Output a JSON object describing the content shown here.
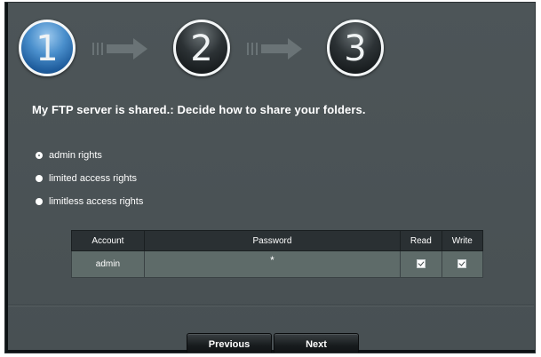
{
  "wizard": {
    "steps": [
      {
        "number": "1",
        "state": "active"
      },
      {
        "number": "2",
        "state": "inactive"
      },
      {
        "number": "3",
        "state": "inactive"
      }
    ]
  },
  "page": {
    "title": "My FTP server is shared.: Decide how to share your folders."
  },
  "access_options": [
    {
      "label": "admin rights",
      "selected": true
    },
    {
      "label": "limited access rights",
      "selected": false
    },
    {
      "label": "limitless access rights",
      "selected": false
    }
  ],
  "accounts_table": {
    "headers": [
      "Account",
      "Password",
      "Read",
      "Write"
    ],
    "rows": [
      {
        "account": "admin",
        "password": "*",
        "read": true,
        "write": true
      }
    ]
  },
  "buttons": {
    "previous": "Previous",
    "next": "Next"
  },
  "colors": {
    "panel_bg": "#4b5356",
    "active_step": "#2f74b7",
    "table_header": "#2a3033",
    "table_row": "#5e6b69"
  },
  "icons": {
    "arrow": "arrow-right-icon",
    "checkbox": "checkbox-checked-icon",
    "radio": "radio-icon"
  }
}
